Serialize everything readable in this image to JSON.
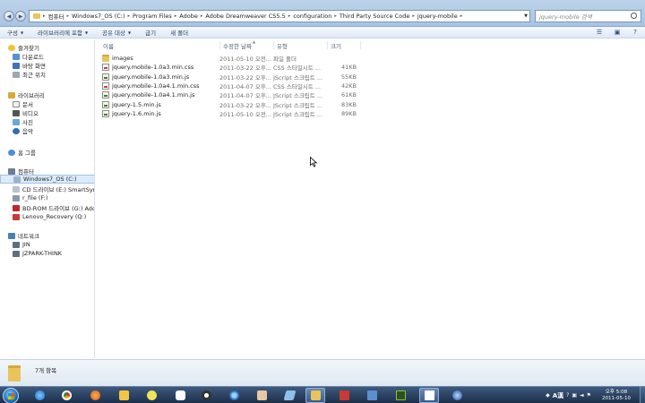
{
  "address": {
    "breadcrumbs": [
      "컴퓨터",
      "Windows7_OS (C:)",
      "Program Files",
      "Adobe",
      "Adobe Dreamweaver CS5.5",
      "configuration",
      "Third Party Source Code",
      "jquery-mobile"
    ]
  },
  "search": {
    "placeholder": "jquery-mobile 검색"
  },
  "toolbar": {
    "organize": "구성",
    "add_to_library": "라이브러리에 포함",
    "share_with": "공유 대상",
    "burn": "굽기",
    "new_folder": "새 폴더"
  },
  "nav": {
    "favorites": "즐겨찾기",
    "downloads": "다운로드",
    "desktop": "바탕 화면",
    "recent": "최근 위치",
    "libraries": "라이브러리",
    "documents": "문서",
    "videos": "비디오",
    "pictures": "사진",
    "music": "음악",
    "homegroup": "홈 그룹",
    "computer": "컴퓨터",
    "drive_c": "Windows7_OS (C:)",
    "drive_e": "CD 드라이브 (E:) SmartSync I",
    "drive_f": "r_file (F:)",
    "drive_g": "BD-ROM 드라이브 (G:) Adobe",
    "drive_q": "Lenovo_Recovery (Q:)",
    "network": "네트워크",
    "net1": "JIN",
    "net2": "JZPARK-THINK"
  },
  "columns": {
    "name": "이름",
    "date": "수정한 날짜",
    "type": "유형",
    "size": "크기"
  },
  "files": [
    {
      "name": "images",
      "date": "2011-05-10 오전...",
      "type": "파일 폴더",
      "size": "",
      "icon": "folder-icon"
    },
    {
      "name": "jquery.mobile-1.0a3.min.css",
      "date": "2011-03-22 오후...",
      "type": "CSS 스타일시트 ...",
      "size": "41KB",
      "icon": "css-file-icon"
    },
    {
      "name": "jquery.mobile-1.0a3.min.js",
      "date": "2011-03-22 오후...",
      "type": "JScript 스크립트 ...",
      "size": "55KB",
      "icon": "js-file-icon"
    },
    {
      "name": "jquery.mobile-1.0a4.1.min.css",
      "date": "2011-04-07 오후...",
      "type": "CSS 스타일시트 ...",
      "size": "42KB",
      "icon": "css-file-icon"
    },
    {
      "name": "jquery.mobile-1.0a4.1.min.js",
      "date": "2011-04-07 오후...",
      "type": "JScript 스크립트 ...",
      "size": "61KB",
      "icon": "js-file-icon"
    },
    {
      "name": "jquery-1.5.min.js",
      "date": "2011-03-22 오후...",
      "type": "JScript 스크립트 ...",
      "size": "83KB",
      "icon": "js-file-icon"
    },
    {
      "name": "jquery-1.6.min.js",
      "date": "2011-05-10 오전...",
      "type": "JScript 스크립트 ...",
      "size": "89KB",
      "icon": "js-file-icon"
    }
  ],
  "details": {
    "item_count": "7개 항목"
  },
  "taskbar": {
    "ime_label": "A漢",
    "time": "오후 5:08",
    "date": "2011-05-10"
  }
}
